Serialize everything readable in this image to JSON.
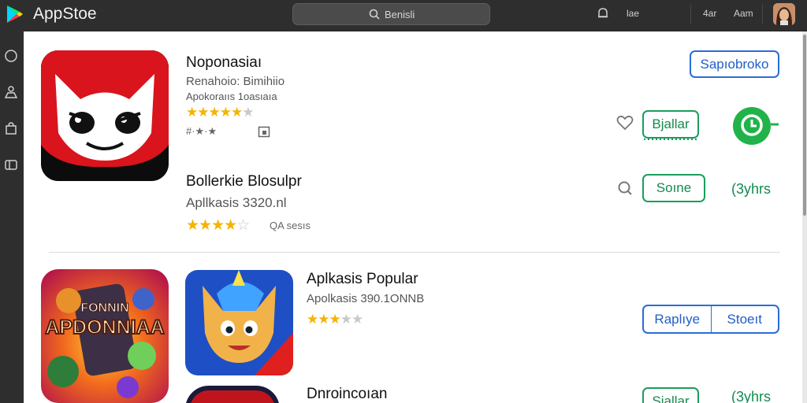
{
  "topbar": {
    "app_title": "AppStoe",
    "search_text": "Benisli",
    "item1": "lae",
    "item2": "4ar",
    "item3": "Aam"
  },
  "apps": [
    {
      "name": "Noponasiaı",
      "line1": "Renahoio:   Bimihiio",
      "line2": "Apokoraııs   1oasıaıa",
      "rating": 4,
      "meta": "#·★·★",
      "action_label": "Sapıobroko",
      "secondary_label": "Bjallar"
    },
    {
      "name": "Bollerkie Blosulpr",
      "line1": "Apllkasis   3320.nl",
      "rating": 3.5,
      "meta": "QA  sesıs",
      "action_label": "Soıne",
      "side_label": "(3yhrs"
    },
    {
      "name": "Aplkasis Popular",
      "line1": "Apolkasis   390.1ONNB",
      "rating": 3,
      "action_left": "Raplıye",
      "action_right": "Stoeıt",
      "tile_text_top": "FONNIN",
      "tile_text_main": "APDONNIAA"
    },
    {
      "name": "Dnroincoıan",
      "action_label": "Sjallar",
      "side_label": "(3yhrs"
    }
  ],
  "colors": {
    "accent_blue": "#2a6dd8",
    "accent_green": "#1a9e5c",
    "star": "#f4b400",
    "red_icon": "#d9141c"
  }
}
